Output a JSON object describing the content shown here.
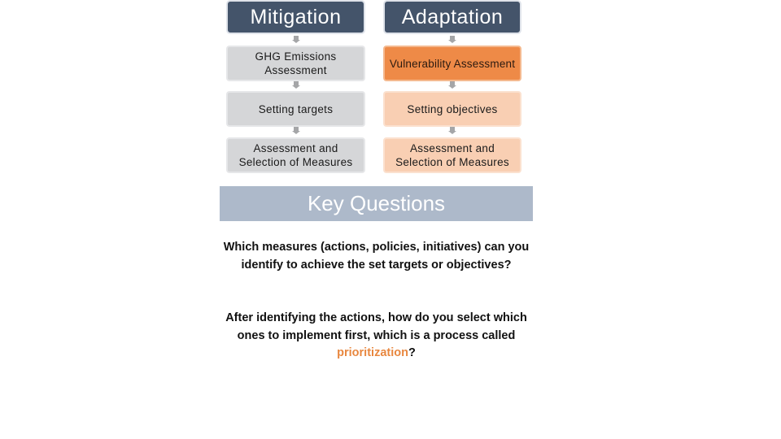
{
  "diagram": {
    "columns": [
      {
        "header": "Mitigation",
        "steps": [
          {
            "label": "GHG Emissions Assessment",
            "lines": [
              "GHG Emissions",
              "Assessment"
            ]
          },
          {
            "label": "Setting targets",
            "lines": [
              "Setting targets"
            ]
          },
          {
            "label": "Assessment and Selection of Measures",
            "lines": [
              "Assessment and",
              "Selection of Measures"
            ]
          }
        ]
      },
      {
        "header": "Adaptation",
        "steps": [
          {
            "label": "Vulnerability Assessment",
            "lines": [
              "Vulnerability Assessment"
            ]
          },
          {
            "label": "Setting objectives",
            "lines": [
              "Setting objectives"
            ]
          },
          {
            "label": "Assessment and Selection of Measures",
            "lines": [
              "Assessment and",
              "Selection of Measures"
            ]
          }
        ]
      }
    ],
    "colors": {
      "header": "#44546a",
      "mitigation_step": "#d5d6d8",
      "adaptation_highlight": "#ee8a47",
      "adaptation_step": "#f9cfb3",
      "key_questions_bar": "#adb9ca",
      "highlight_text": "#e8873f"
    }
  },
  "key_questions": {
    "title": "Key Questions",
    "question_1": "Which measures (actions, policies, initiatives) can you identify to achieve the set targets or objectives?",
    "question_2_prefix": "After identifying the actions, how do you select which ones to implement first, which is a process called ",
    "question_2_highlight": "prioritization",
    "question_2_suffix": "?"
  }
}
